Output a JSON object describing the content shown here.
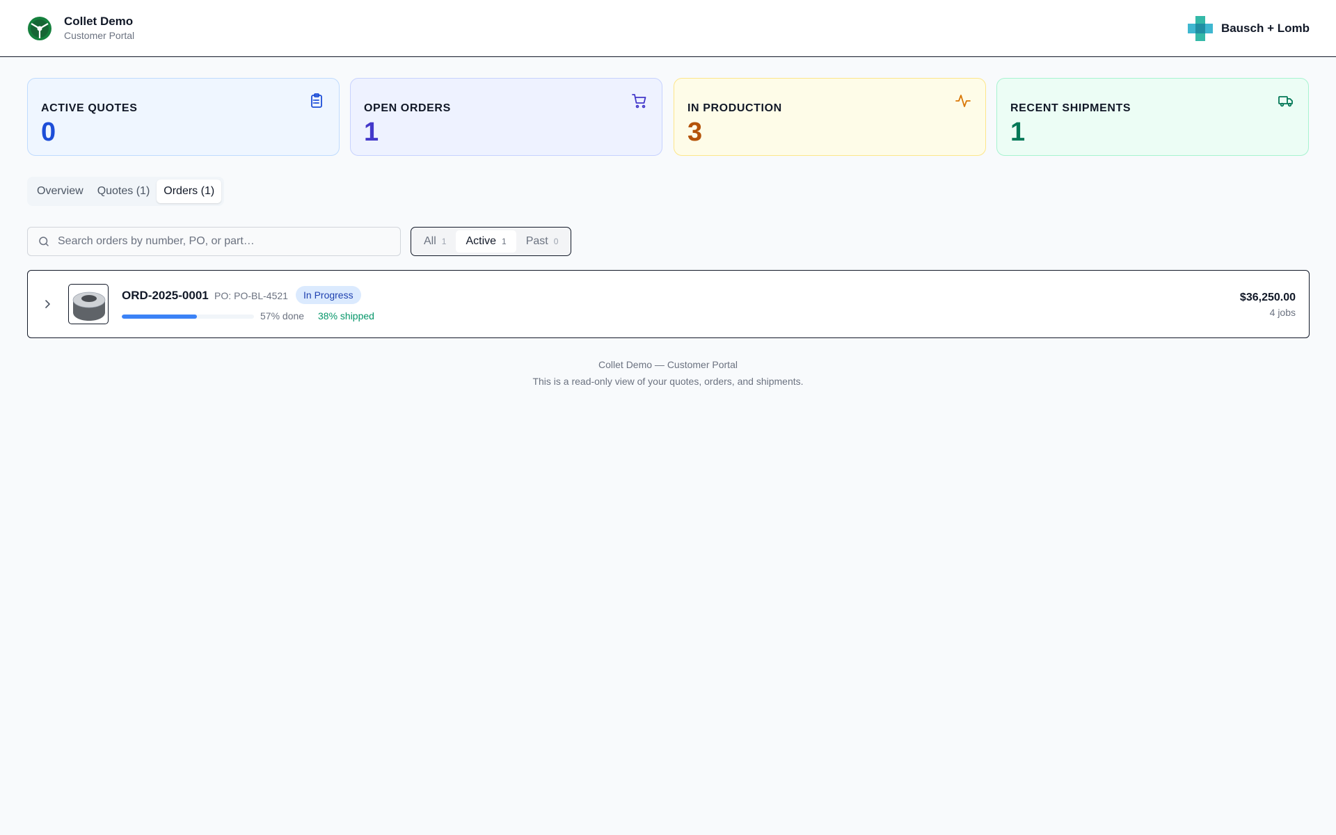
{
  "header": {
    "brand_title": "Collet Demo",
    "brand_subtitle": "Customer Portal",
    "customer_name": "Bausch + Lomb"
  },
  "stats": [
    {
      "label": "ACTIVE QUOTES",
      "value": "0",
      "icon": "clipboard-icon",
      "accent": "#1d4ed8"
    },
    {
      "label": "OPEN ORDERS",
      "value": "1",
      "icon": "cart-icon",
      "accent": "#4338ca"
    },
    {
      "label": "IN PRODUCTION",
      "value": "3",
      "icon": "activity-icon",
      "accent": "#b45309"
    },
    {
      "label": "RECENT SHIPMENTS",
      "value": "1",
      "icon": "truck-icon",
      "accent": "#047857"
    }
  ],
  "tabs": [
    {
      "label": "Overview",
      "active": false
    },
    {
      "label": "Quotes (1)",
      "active": false
    },
    {
      "label": "Orders (1)",
      "active": true
    }
  ],
  "search": {
    "placeholder": "Search orders by number, PO, or part…",
    "value": ""
  },
  "filters": [
    {
      "label": "All",
      "count": "1",
      "active": false
    },
    {
      "label": "Active",
      "count": "1",
      "active": true
    },
    {
      "label": "Past",
      "count": "0",
      "active": false
    }
  ],
  "orders": [
    {
      "number": "ORD-2025-0001",
      "po_label": "PO:",
      "po": "PO-BL-4521",
      "status": "In Progress",
      "progress_fraction": 0.57,
      "done_text": "57% done",
      "shipped_text": "38% shipped",
      "amount": "$36,250.00",
      "jobs": "4 jobs"
    }
  ],
  "footer": {
    "line1": "Collet Demo — Customer Portal",
    "line2": "This is a read-only view of your quotes, orders, and shipments."
  },
  "colors": {
    "progress": "#3b82f6",
    "shipped": "#059669",
    "badge_bg": "#dbeafe",
    "badge_text": "#1e40af"
  }
}
